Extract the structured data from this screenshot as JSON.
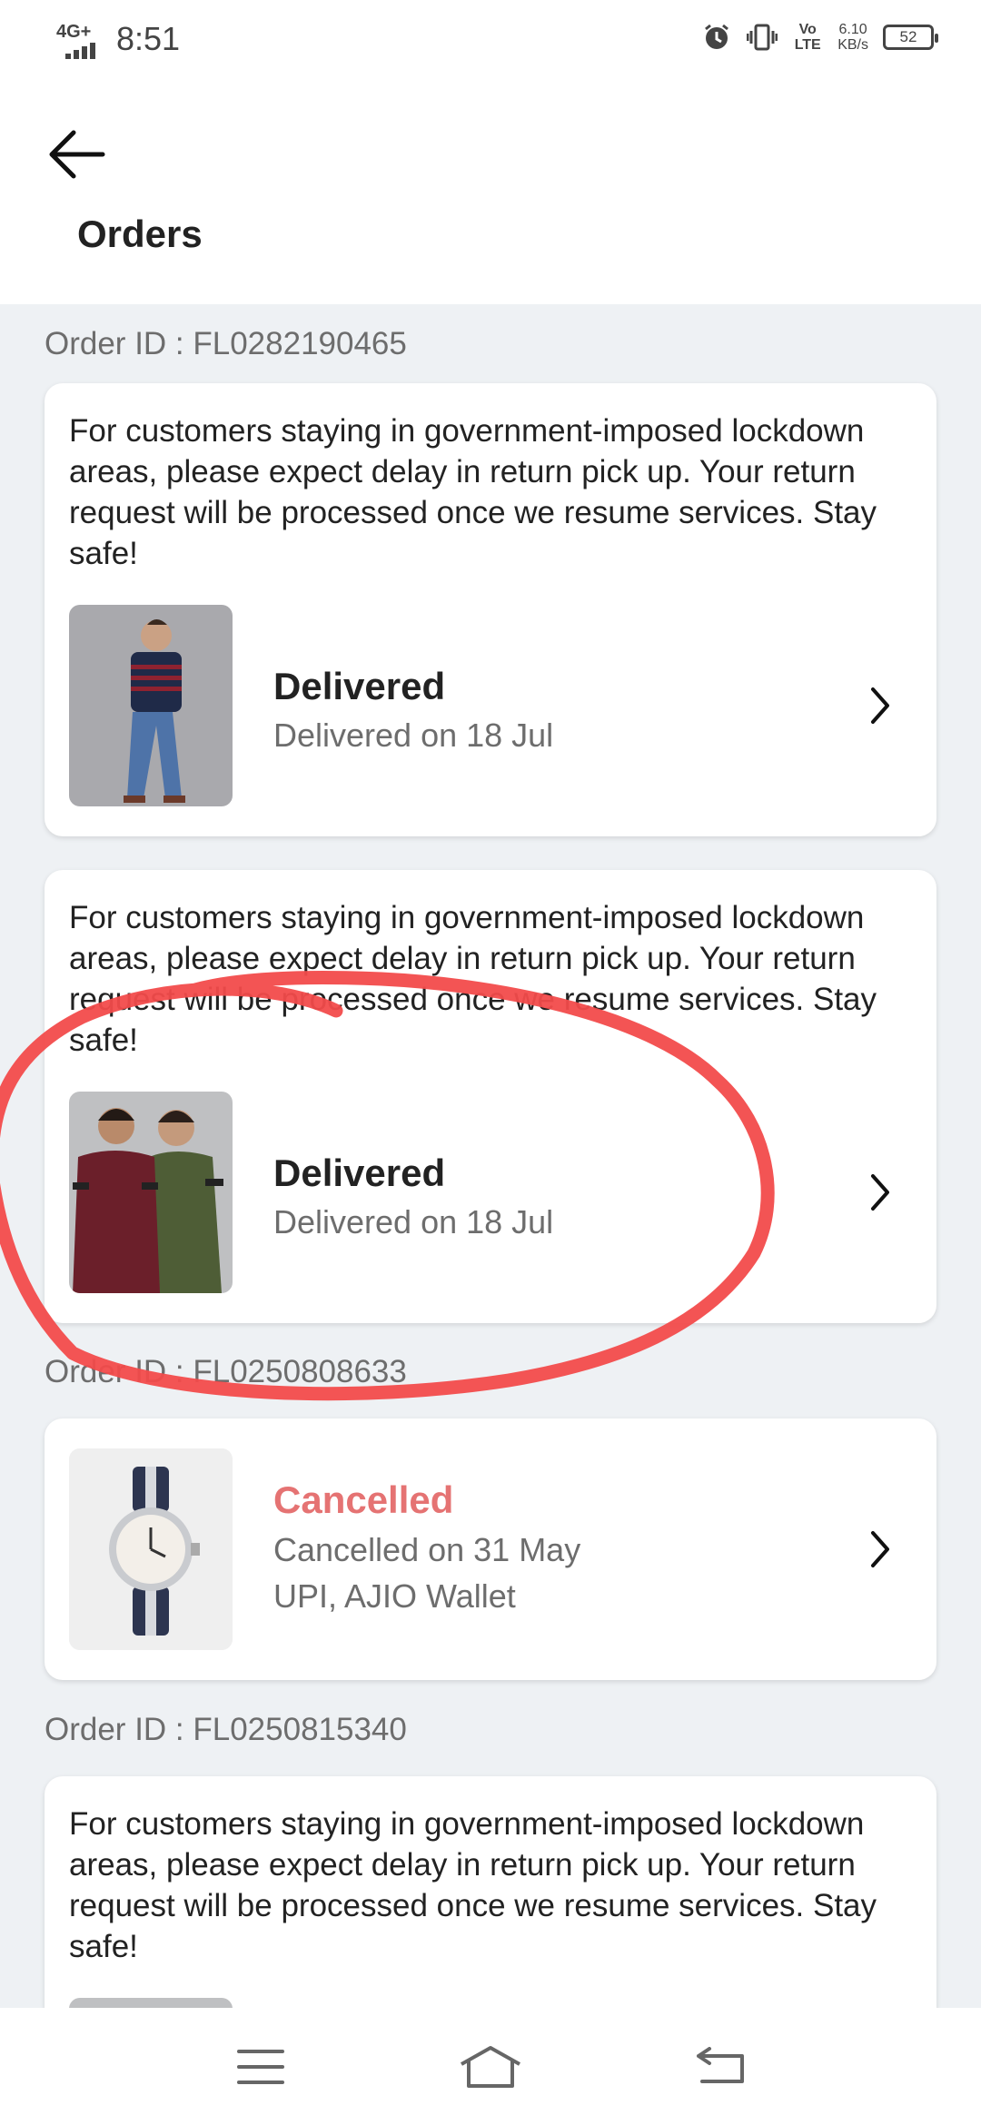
{
  "status_bar": {
    "network": "4G+",
    "time": "8:51",
    "volte": "Vo LTE",
    "speed_value": "6.10",
    "speed_unit": "KB/s",
    "battery": "52"
  },
  "header": {
    "title": "Orders",
    "back_icon": "arrow-left-icon"
  },
  "orders": [
    {
      "order_id_label": "Order ID : FL0282190465",
      "items": [
        {
          "notice": "For customers staying in government-imposed lockdown areas, please expect delay in return pick up. Your return request will be processed once we resume services. Stay safe!",
          "status": "Delivered",
          "detail": "Delivered on 18 Jul",
          "thumb": "striped-tshirt-model"
        },
        {
          "notice": "For customers staying in government-imposed lockdown areas, please expect delay in return pick up. Your return request will be processed once we resume services. Stay safe!",
          "status": "Delivered",
          "detail": "Delivered on 18 Jul",
          "thumb": "two-tshirts-models"
        }
      ]
    },
    {
      "order_id_label": "Order ID : FL0250808633",
      "items": [
        {
          "status": "Cancelled",
          "detail": "Cancelled on 31 May",
          "payment": "UPI, AJIO Wallet",
          "thumb": "watch"
        }
      ]
    },
    {
      "order_id_label": "Order ID : FL0250815340",
      "items": [
        {
          "notice": "For customers staying in government-imposed lockdown areas, please expect delay in return pick up. Your return request will be processed once we resume services. Stay safe!"
        }
      ]
    }
  ],
  "colors": {
    "background": "#eef1f4",
    "cancelled": "#e57373",
    "annotation": "#f24b4b"
  },
  "nav_icons": [
    "menu-icon",
    "home-icon",
    "back-icon"
  ]
}
